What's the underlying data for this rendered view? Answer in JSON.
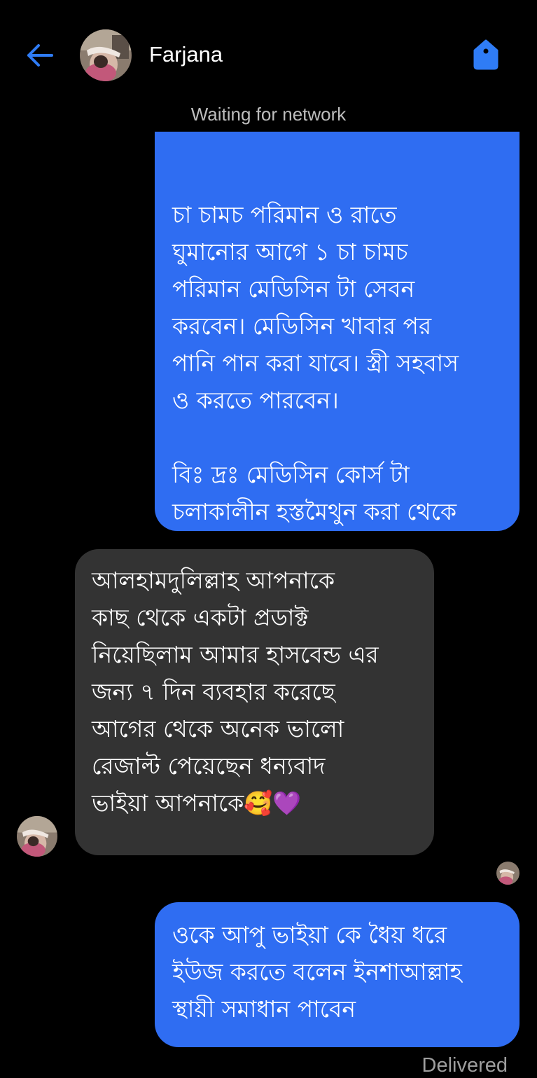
{
  "header": {
    "contact_name": "Farjana",
    "status": "Waiting for network",
    "back_icon": "arrow-left-icon",
    "action_icon": "tag-icon",
    "accent_color": "#2f7cf6"
  },
  "messages": [
    {
      "direction": "outgoing",
      "text": "চা চামচ পরিমান ও রাতে\nঘুমানোর আগে ১ চা চামচ\nপরিমান মেডিসিন টা সেবন\nকরবেন। মেডিসিন খাবার পর\nপানি পান করা যাবে। স্ত্রী সহবাস\nও করতে পারবেন।\n\nবিঃ দ্রঃ মেডিসিন কোর্স টা\nচলাকালীন হস্তমৈথুন করা থেকে\nযথা সম্ভব বিরত থাকুন।"
    },
    {
      "direction": "incoming",
      "text": "আলহামদুলিল্লাহ আপনাকে\nকাছ থেকে একটা প্রডাক্ট\nনিয়েছিলাম আমার হাসবেন্ড এর\nজন্য ৭ দিন ব্যবহার করেছে\nআগের থেকে অনেক ভালো\nরেজাল্ট পেয়েছেন ধন্যবাদ\nভাইয়া আপনাকে🥰💜"
    },
    {
      "direction": "outgoing",
      "text": "ওকে আপু ভাইয়া কে ধৈয় ধরে\nইউজ করতে বলেন ইনশাআল্লাহ\nস্থায়ী সমাধান পাবেন"
    }
  ],
  "delivery_status": "Delivered",
  "colors": {
    "background": "#000000",
    "outgoing_bubble": "#2f6df2",
    "incoming_bubble": "#333333"
  }
}
